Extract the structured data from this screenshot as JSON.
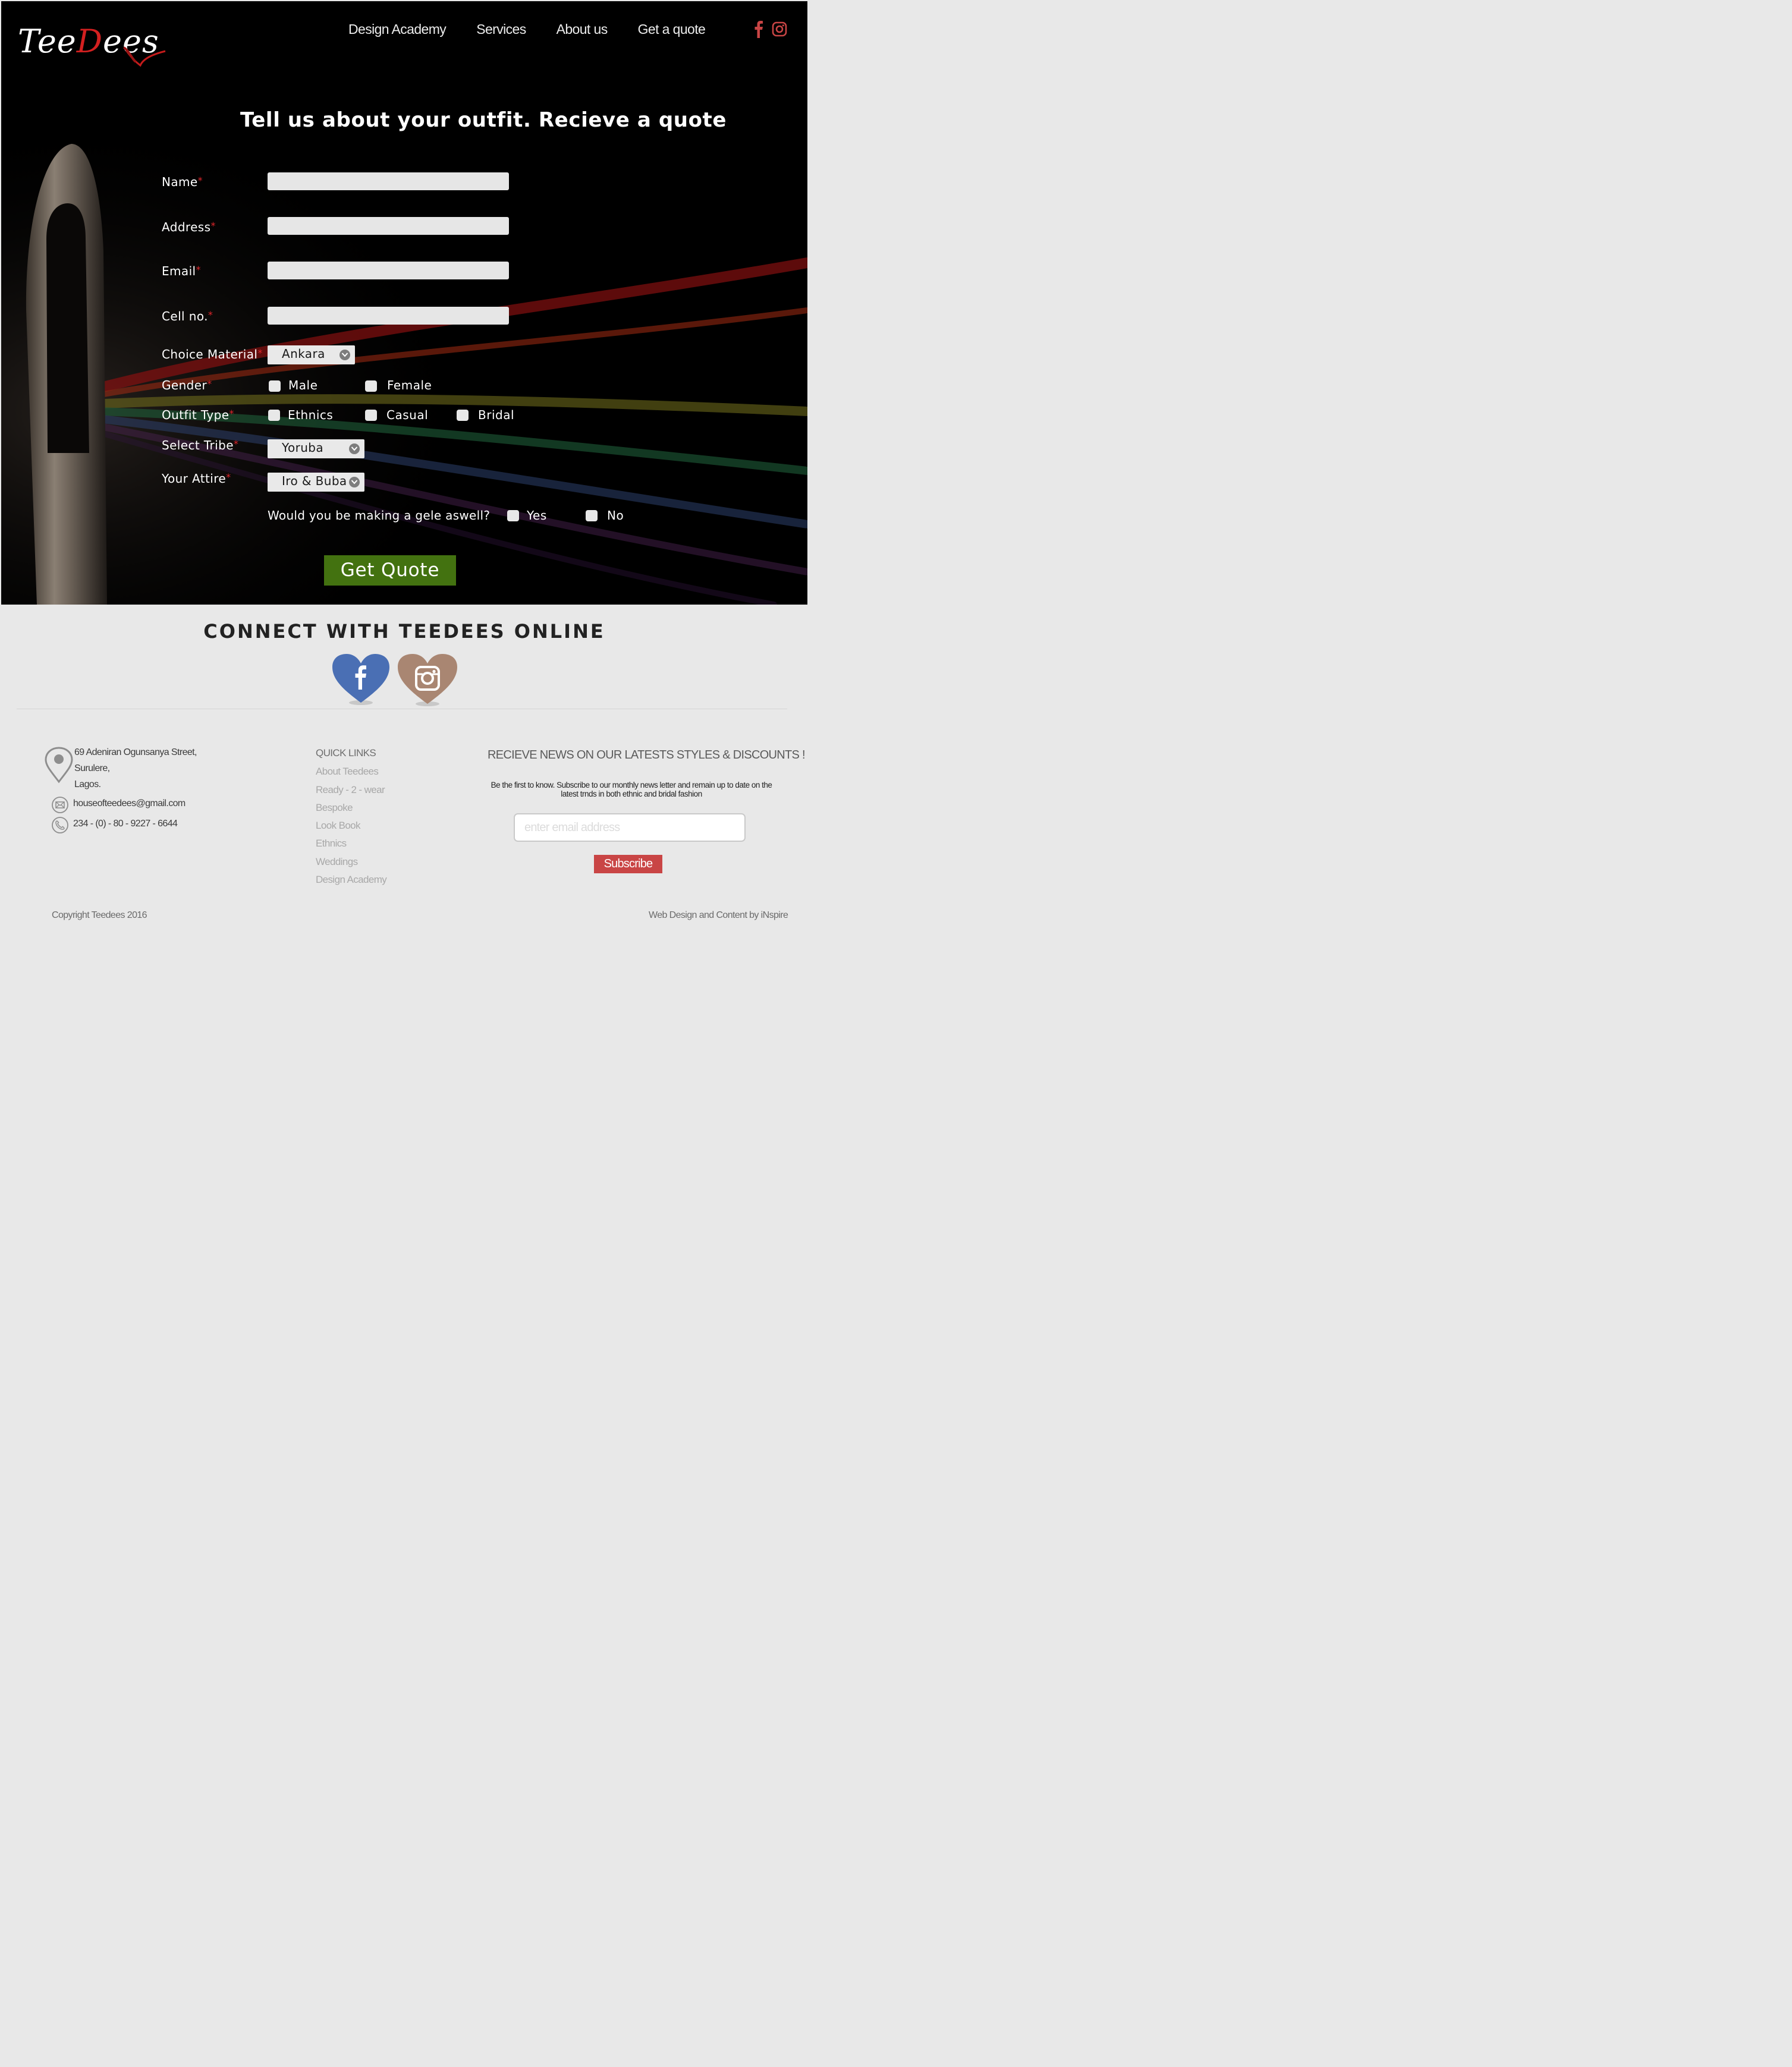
{
  "brand": {
    "logo_part1": "Tee",
    "logo_d": "D",
    "logo_part2": "ees",
    "accent_color": "#d32020"
  },
  "nav": {
    "items": [
      "Design Academy",
      "Services",
      "About us",
      "Get a quote"
    ],
    "social_icons": [
      "facebook-icon",
      "instagram-icon"
    ],
    "social_color": "#c94545"
  },
  "hero": {
    "title": "Tell us about your outfit. Recieve a quote"
  },
  "form": {
    "required_mark": "*",
    "name_label": "Name",
    "address_label": "Address",
    "email_label": "Email",
    "cell_label": "Cell no.",
    "material_label": "Choice Material",
    "material_value": "Ankara",
    "gender_label": "Gender",
    "gender_options": [
      "Male",
      "Female"
    ],
    "outfit_label": "Outfit Type",
    "outfit_options": [
      "Ethnics",
      "Casual",
      "Bridal"
    ],
    "tribe_label": "Select Tribe",
    "tribe_value": "Yoruba",
    "attire_label": "Your Attire",
    "attire_value": "Iro & Buba",
    "gele_question": "Would you be making a gele aswell?",
    "gele_options": [
      "Yes",
      "No"
    ],
    "submit_label": "Get Quote",
    "submit_color": "#437210"
  },
  "connect": {
    "title": "CONNECT WITH TEEDEES ONLINE",
    "icons": [
      "facebook-heart-icon",
      "instagram-heart-icon"
    ]
  },
  "footer": {
    "address_lines": [
      "69 Adeniran Ogunsanya Street,",
      "Surulere,",
      "Lagos."
    ],
    "email": "houseofteedees@gmail.com",
    "phone": "234 - (0) - 80 - 9227 - 6644",
    "quick_links_title": "QUICK LINKS",
    "quick_links": [
      "About Teedees",
      "Ready - 2 - wear",
      "Bespoke",
      "Look Book",
      "Ethnics",
      "Weddings",
      "Design Academy"
    ],
    "newsletter_title": "RECIEVE NEWS ON OUR LATESTS STYLES & DISCOUNTS !",
    "newsletter_text": "Be the first to know. Subscribe to our monthly news letter  and remain up to date on the latest trnds in both ethnic and bridal fashion",
    "email_placeholder": "enter email address",
    "subscribe_label": "Subscribe",
    "copyright": "Copyright Teedees 2016",
    "credit": "Web Design and Content by iNspire"
  }
}
